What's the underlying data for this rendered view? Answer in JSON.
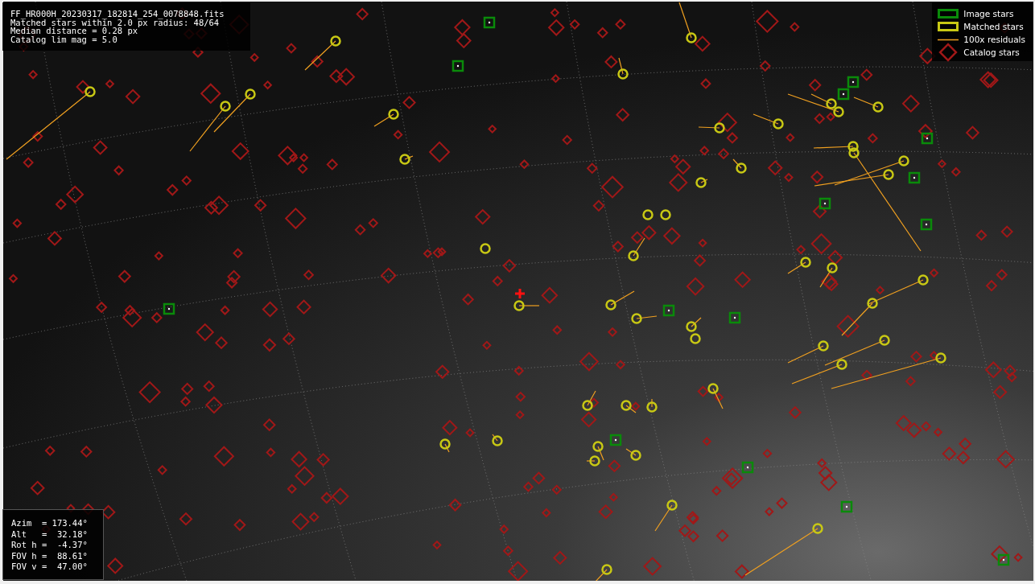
{
  "info_box": {
    "lines": [
      "FF_HR000H_20230317_182814_254_0078848.fits",
      "Matched stars within 2.0 px radius: 48/64",
      "Median distance = 0.28 px",
      "Catalog lim mag = 5.0"
    ]
  },
  "legend": [
    {
      "kind": "image",
      "label": "Image stars"
    },
    {
      "kind": "matched",
      "label": "Matched stars"
    },
    {
      "kind": "residual",
      "label": "100x residuals"
    },
    {
      "kind": "catalog",
      "label": "Catalog stars"
    }
  ],
  "pointing_box": {
    "lines": [
      "Azim  = 173.44°",
      "Alt   =  32.18°",
      "Rot h =  -4.37°",
      "FOV h =  88.61°",
      "FOV v =  47.00°"
    ]
  }
}
